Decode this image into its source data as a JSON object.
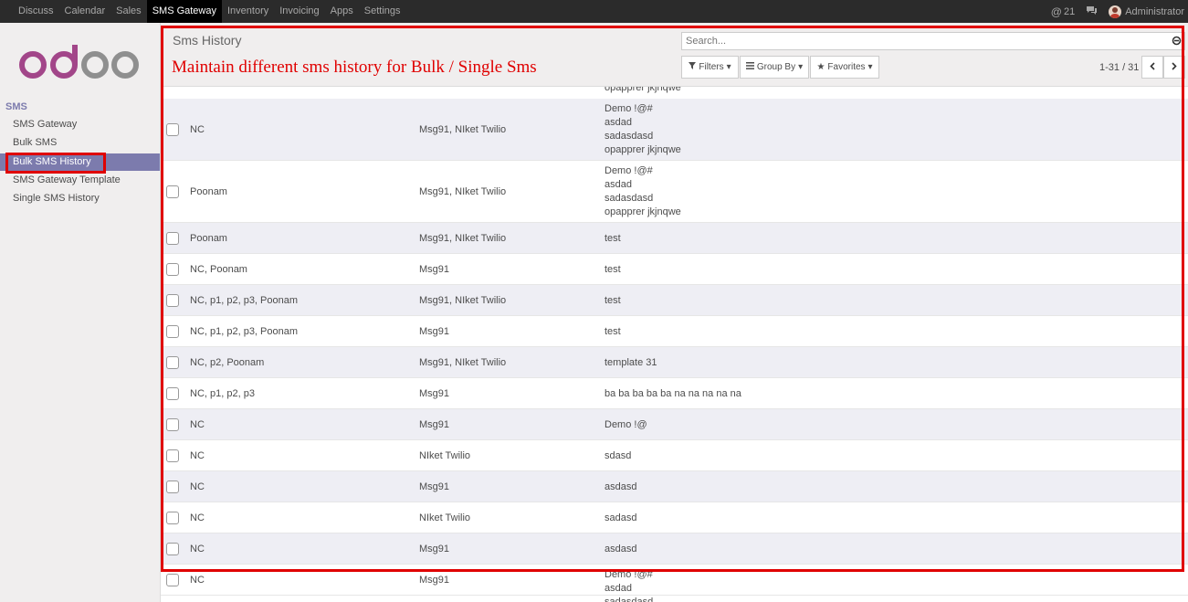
{
  "topbar": {
    "menu": [
      "Discuss",
      "Calendar",
      "Sales",
      "SMS Gateway",
      "Inventory",
      "Invoicing",
      "Apps",
      "Settings"
    ],
    "active": "SMS Gateway",
    "mention_count": "21",
    "user": "Administrator"
  },
  "sidebar": {
    "logo": "odoo",
    "section": "SMS",
    "items": [
      "SMS Gateway",
      "Bulk SMS",
      "Bulk SMS History",
      "SMS Gateway Template",
      "Single SMS History"
    ],
    "active_item": "Bulk SMS History"
  },
  "control_panel": {
    "breadcrumb": "Sms History",
    "annotation": "Maintain different sms history for Bulk / Single Sms",
    "search_placeholder": "Search...",
    "filters_label": "Filters",
    "groupby_label": "Group By",
    "favorites_label": "Favorites",
    "pager": "1-31 / 31"
  },
  "list": {
    "partial_top_line": "opapprer jkjnqwe",
    "rows": [
      {
        "recipients": "NC",
        "gateways": "Msg91, NIket Twilio",
        "message": [
          "Demo !@#",
          "asdad",
          "sadasdasd",
          "opapprer jkjnqwe"
        ]
      },
      {
        "recipients": "Poonam",
        "gateways": "Msg91, NIket Twilio",
        "message": [
          "Demo !@#",
          "asdad",
          "sadasdasd",
          "opapprer jkjnqwe"
        ]
      },
      {
        "recipients": "Poonam",
        "gateways": "Msg91, NIket Twilio",
        "message": [
          "test"
        ]
      },
      {
        "recipients": "NC, Poonam",
        "gateways": "Msg91",
        "message": [
          "test"
        ]
      },
      {
        "recipients": "NC, p1, p2, p3, Poonam",
        "gateways": "Msg91, NIket Twilio",
        "message": [
          "test"
        ]
      },
      {
        "recipients": "NC, p1, p2, p3, Poonam",
        "gateways": "Msg91",
        "message": [
          "test"
        ]
      },
      {
        "recipients": "NC, p2, Poonam",
        "gateways": "Msg91, NIket Twilio",
        "message": [
          "template 31"
        ]
      },
      {
        "recipients": "NC, p1, p2, p3",
        "gateways": "Msg91",
        "message": [
          "ba ba ba ba ba na na na na na"
        ]
      },
      {
        "recipients": "NC",
        "gateways": "Msg91",
        "message": [
          "Demo !@"
        ]
      },
      {
        "recipients": "NC",
        "gateways": "NIket Twilio",
        "message": [
          "sdasd"
        ]
      },
      {
        "recipients": "NC",
        "gateways": "Msg91",
        "message": [
          "asdasd"
        ]
      },
      {
        "recipients": "NC",
        "gateways": "NIket Twilio",
        "message": [
          "sadasd"
        ]
      },
      {
        "recipients": "NC",
        "gateways": "Msg91",
        "message": [
          "asdasd"
        ]
      },
      {
        "recipients": "NC",
        "gateways": "Msg91",
        "message": [
          "Demo !@#",
          "asdad",
          "sadasdasd"
        ]
      }
    ]
  },
  "colors": {
    "navbar": "#2b2b2b",
    "accent": "#7c7bad",
    "logo": "#a24689",
    "annotation": "#e00000",
    "row_stripe": "#eeeef4"
  }
}
